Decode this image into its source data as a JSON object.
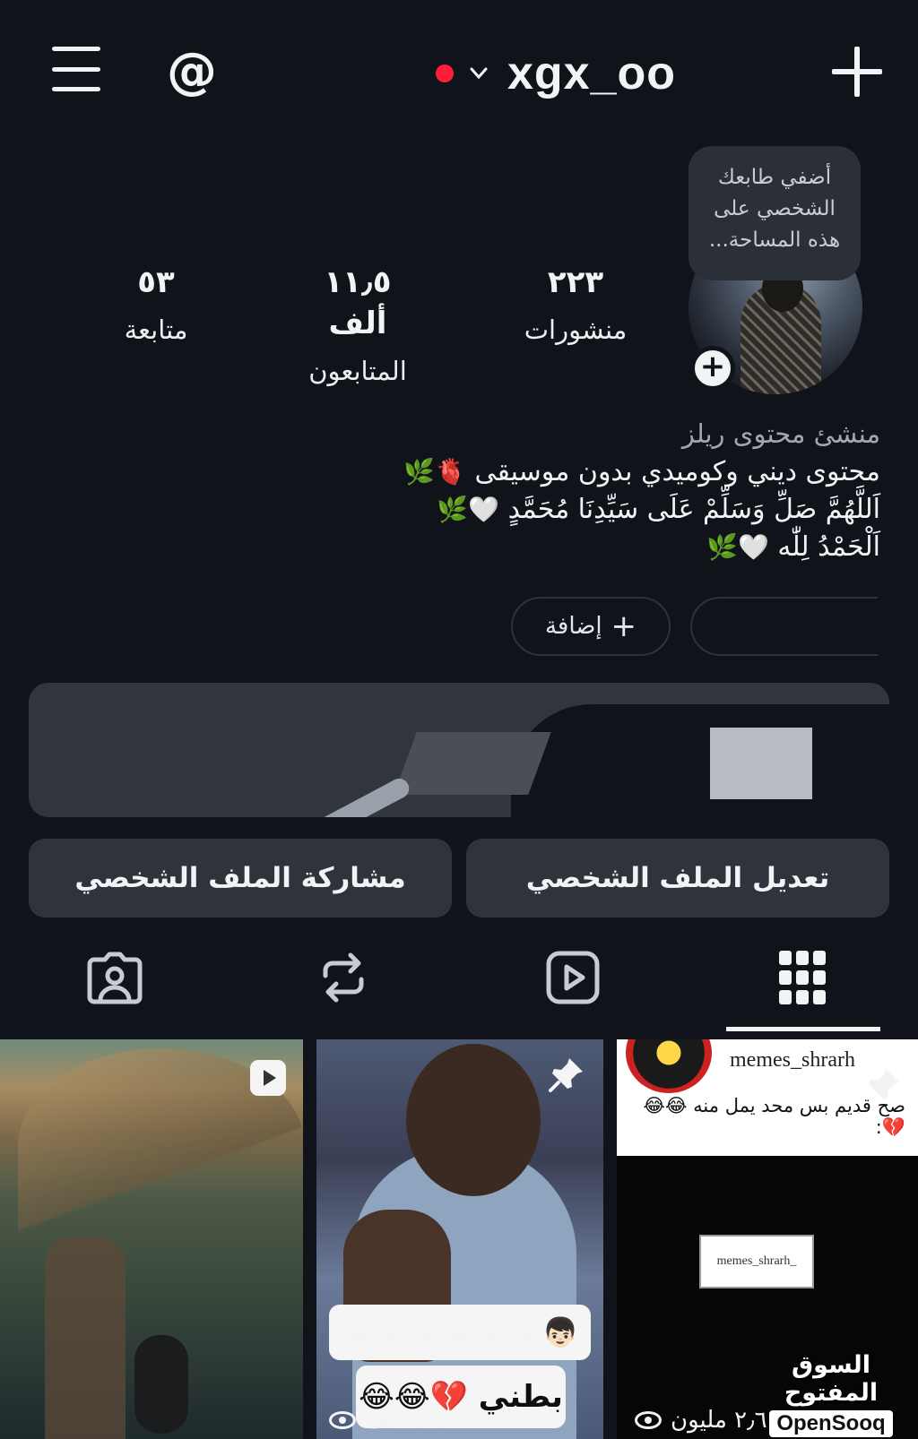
{
  "header": {
    "username": "xgx_oo",
    "menu_icon": "hamburger-menu-icon",
    "threads_icon": "threads-icon",
    "add_icon": "plus-icon",
    "live_dot_color": "#ff1e3c"
  },
  "note": {
    "line1": "أضفي طابعك",
    "line2": "الشخصي على",
    "line3": "هذه المساحة..."
  },
  "stats": {
    "posts": {
      "value": "٢٢٣",
      "label": "منشورات"
    },
    "followers": {
      "value": "١١٫٥ ألف",
      "label": "المتابعون"
    },
    "following": {
      "value": "٥٣",
      "label": "متابعة"
    }
  },
  "bio": {
    "category": "منشئ محتوى ريلز",
    "line1": "محتوى ديني وكوميدي بدون موسيقى",
    "line1_emoji": "🫀🌿",
    "line2": "اَللَّهُمَّ صَلِّ وَسَلِّمْ عَلَى سَيِّدِنَا مُحَمَّدٍ",
    "line2_emoji": "🤍🌿",
    "line3": "اَلْحَمْدُ لِلّٰه",
    "line3_emoji": "🤍🌿"
  },
  "highlights": {
    "add_label": "إضافة"
  },
  "actions": {
    "edit_profile": "تعديل الملف الشخصي",
    "share_profile": "مشاركة الملف الشخصي"
  },
  "tabs": [
    {
      "name": "grid",
      "icon": "grid-icon",
      "active": true
    },
    {
      "name": "reels",
      "icon": "reels-icon"
    },
    {
      "name": "reposts",
      "icon": "repost-icon"
    },
    {
      "name": "tagged",
      "icon": "tagged-user-icon"
    }
  ],
  "posts": [
    {
      "type": "reel",
      "icon": "reel-play-icon"
    },
    {
      "type": "pinned",
      "icon": "pin-icon",
      "caption1": "😂😂😂😂😂😂👦🏻",
      "caption2": "بطني 💔😂😂",
      "views": "٩١١ ألف"
    },
    {
      "type": "pinned",
      "account": "memes_shrarh",
      "text": "صح قديم بس محد يمل منه 😂😂💔:",
      "watermark": "memes_shrarh_",
      "views": "٢٫٦ مليون"
    }
  ],
  "watermark": {
    "arabic": "السوق المفتوح",
    "english": "OpenSooq"
  }
}
